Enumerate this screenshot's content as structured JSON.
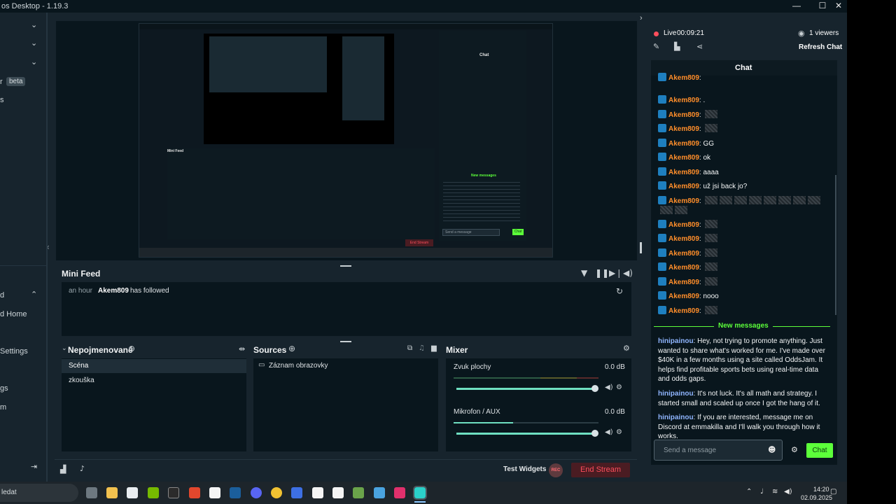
{
  "window": {
    "title": "os Desktop - 1.19.3",
    "minimize": "—",
    "maximize": "☐",
    "close": "✕"
  },
  "leftnav": {
    "labels": [
      "r",
      "s",
      "d",
      "d Home",
      "Settings",
      "gs",
      "m"
    ],
    "beta": "beta"
  },
  "preview": {
    "inner": {
      "chat_title": "Chat",
      "new_messages": "New messages",
      "mini_feed": "Mini Feed",
      "end_stream": "End Stream",
      "send_placeholder": "Send a message",
      "chat_btn": "Chat"
    }
  },
  "minifeed": {
    "title": "Mini Feed",
    "time": "an hour",
    "user": "Akem809",
    "action": "has followed"
  },
  "scenes": {
    "title": "Nepojmenované",
    "items": [
      "Scéna",
      "zkouška"
    ]
  },
  "sources": {
    "title": "Sources",
    "items": [
      "Záznam obrazovky"
    ]
  },
  "mixer": {
    "title": "Mixer",
    "channels": [
      {
        "name": "Zvuk plochy",
        "db": "0.0 dB",
        "level": 1.0
      },
      {
        "name": "Mikrofon / AUX",
        "db": "0.0 dB",
        "level": 1.0
      }
    ]
  },
  "footer": {
    "test_widgets": "Test Widgets",
    "rec": "REC",
    "end_stream": "End Stream"
  },
  "chat": {
    "live_label": "Live",
    "live_time": "00:09:21",
    "viewers": "1 viewers",
    "refresh": "Refresh Chat",
    "title": "Chat",
    "messages": [
      {
        "user": "Akem809",
        "text": ""
      },
      {
        "user": "Akem809",
        "text": "."
      },
      {
        "user": "Akem809",
        "text": ""
      },
      {
        "user": "Akem809",
        "text": ""
      },
      {
        "user": "Akem809",
        "text": "GG"
      },
      {
        "user": "Akem809",
        "text": "ok"
      },
      {
        "user": "Akem809",
        "text": "aaaa"
      },
      {
        "user": "Akem809",
        "text": "už jsi back jo?"
      },
      {
        "user": "Akem809",
        "text": ""
      },
      {
        "user": "Akem809",
        "text": ""
      },
      {
        "user": "Akem809",
        "text": ""
      },
      {
        "user": "Akem809",
        "text": ""
      },
      {
        "user": "Akem809",
        "text": ""
      },
      {
        "user": "Akem809",
        "text": ""
      },
      {
        "user": "Akem809",
        "text": "nooo"
      },
      {
        "user": "Akem809",
        "text": ""
      }
    ],
    "new_messages": "New messages",
    "spam": [
      {
        "user": "hinipainou",
        "text": "Hey, not trying to promote anything. Just wanted to share what's worked for me. I've made over $40K in a few months using a site called OddsJam. It helps find profitable sports bets using real-time data and odds gaps."
      },
      {
        "user": "hinipainou",
        "text": "It's not luck. It's all math and strategy. I started small and scaled up once I got the hang of it."
      },
      {
        "user": "hinipainou",
        "text": "If you are interested, message me on Discord at emmakilla and I'll walk you through how it works."
      }
    ],
    "input_placeholder": "Send a message",
    "chat_button": "Chat"
  },
  "taskbar": {
    "search": "ledat",
    "time": "14:20",
    "date": "02.09.2025"
  },
  "colors": {
    "accent_green": "#5cff3a",
    "end_stream_red": "#ff4e5c",
    "username_orange": "#ff8e2b",
    "username_blue": "#8fb5ff",
    "teal": "#6fe0c2"
  }
}
